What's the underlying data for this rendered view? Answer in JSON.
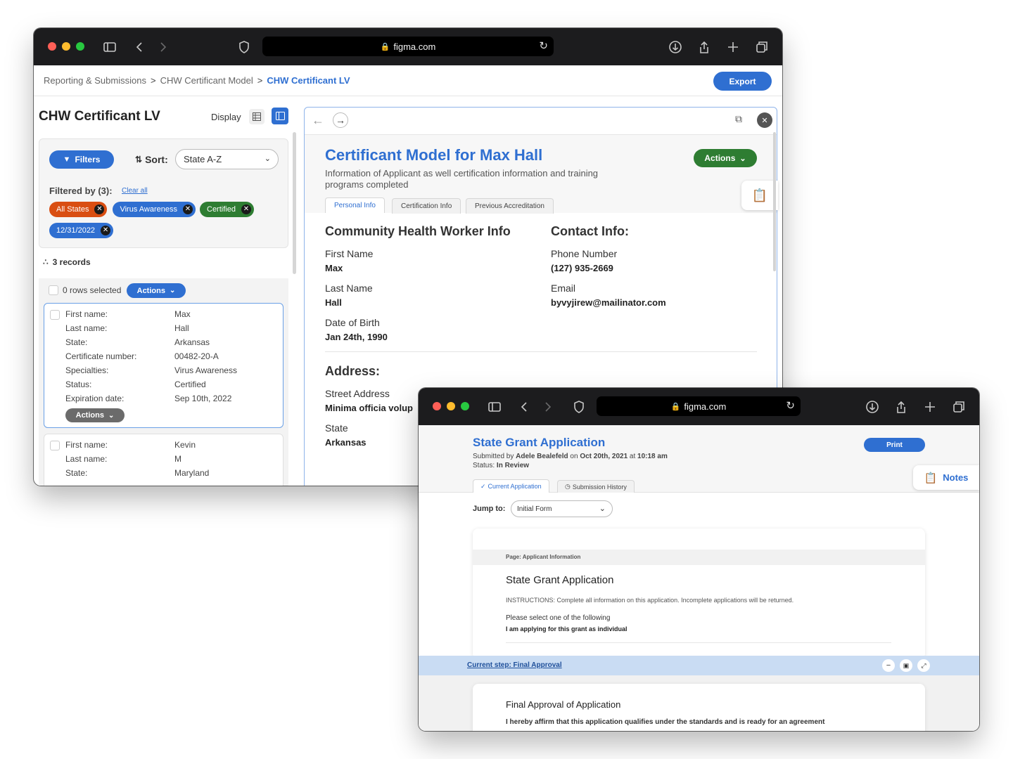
{
  "browser1": {
    "url": "figma.com",
    "breadcrumb": [
      "Reporting & Submissions",
      "CHW Certificant Model",
      "CHW Certificant LV"
    ],
    "breadcrumb_sep": ">",
    "export_label": "Export"
  },
  "left_panel": {
    "title": "CHW Certificant LV",
    "display_label": "Display",
    "filters_label": "Filters",
    "sort_label": "Sort:",
    "sort_value": "State A-Z",
    "filtered_by": "Filtered by (3):",
    "clear_all": "Clear all",
    "chips": [
      {
        "label": "All States",
        "color": "#d94e12"
      },
      {
        "label": "Virus Awareness",
        "color": "#2f6fd1"
      },
      {
        "label": "Certified",
        "color": "#2e7d32"
      },
      {
        "label": "12/31/2022",
        "color": "#2f6fd1"
      }
    ],
    "records_count": "3 records",
    "rows_selected": "0 rows selected",
    "actions_label": "Actions",
    "record1": {
      "rows": [
        {
          "k": "First name:",
          "v": "Max"
        },
        {
          "k": "Last name:",
          "v": "Hall"
        },
        {
          "k": "State:",
          "v": "Arkansas"
        },
        {
          "k": "Certificate number:",
          "v": "00482-20-A"
        },
        {
          "k": "Specialties:",
          "v": "Virus Awareness"
        },
        {
          "k": "Status:",
          "v": "Certified"
        },
        {
          "k": "Expiration date:",
          "v": "Sep 10th, 2022"
        }
      ],
      "actions_label": "Actions"
    },
    "record2": {
      "rows": [
        {
          "k": "First name:",
          "v": "Kevin"
        },
        {
          "k": "Last name:",
          "v": "M"
        },
        {
          "k": "State:",
          "v": "Maryland"
        }
      ]
    }
  },
  "detail": {
    "title": "Certificant Model for Max Hall",
    "subtitle": "Information of Applicant as well certification information and training programs completed",
    "actions_label": "Actions",
    "tabs": [
      "Personal Info",
      "Certification Info",
      "Previous Accreditation"
    ],
    "chw_heading": "Community Health Worker Info",
    "contact_heading": "Contact Info:",
    "fields": {
      "first_name_label": "First Name",
      "first_name": "Max",
      "last_name_label": "Last Name",
      "last_name": "Hall",
      "dob_label": "Date of Birth",
      "dob": "Jan 24th, 1990",
      "phone_label": "Phone Number",
      "phone": "(127) 935-2669",
      "email_label": "Email",
      "email": "byvyjirew@mailinator.com"
    },
    "address_heading": "Address:",
    "street_label": "Street Address",
    "street": "Minima officia volup",
    "state_label": "State",
    "state": "Arkansas"
  },
  "browser2": {
    "url": "figma.com",
    "title": "State Grant Application",
    "submitted_prefix": "Submitted by",
    "submitted_by": "Adele Bealefeld",
    "submitted_on": "on",
    "submitted_date": "Oct 20th, 2021",
    "submitted_at": "at",
    "submitted_time": "10:18 am",
    "status_label": "Status:",
    "status_value": "In Review",
    "print_label": "Print",
    "notes_label": "Notes",
    "tabs": [
      "Current Application",
      "Submission History"
    ],
    "jump_label": "Jump to:",
    "jump_value": "Initial Form",
    "page_label": "Page: Applicant Information",
    "form_title": "State Grant Application",
    "instructions": "INSTRUCTIONS: Complete all information on this application. Incomplete applications will be returned.",
    "select_prompt": "Please select one of the following",
    "select_answer": "I am applying for this grant as individual",
    "current_step": "Current step: Final Approval",
    "final_title": "Final Approval of Application",
    "final_text": "I hereby affirm that this application qualifies under the standards and is ready for an agreement"
  }
}
